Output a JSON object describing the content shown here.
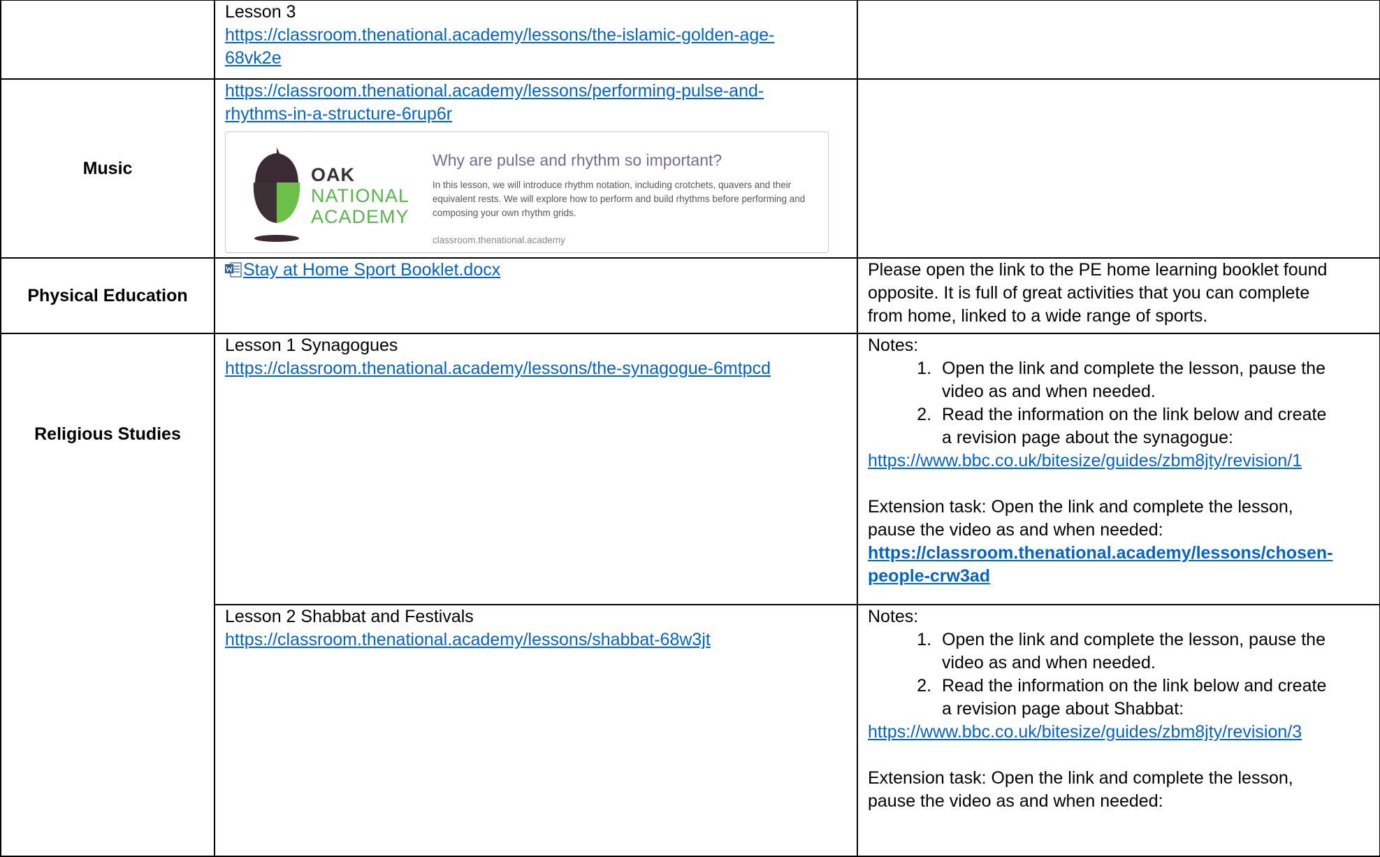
{
  "rows": {
    "row_lesson3": {
      "label": "Lesson 3",
      "link": "https://classroom.thenational.academy/lessons/the-islamic-golden-age-68vk2e",
      "link_line1": "https://classroom.thenational.academy/lessons/the-islamic-golden-age-",
      "link_line2": "68vk2e"
    },
    "music": {
      "subject": "Music",
      "link": "https://classroom.thenational.academy/lessons/performing-pulse-and-rhythms-in-a-structure-6rup6r",
      "link_line1": "https://classroom.thenational.academy/lessons/performing-pulse-and-",
      "link_line2": "rhythms-in-a-structure-6rup6r",
      "card": {
        "brand_line1": "OAK",
        "brand_line2": "NATIONAL",
        "brand_line3": "ACADEMY",
        "title": "Why are pulse and rhythm so important?",
        "description": "In this lesson, we will introduce rhythm notation, including crotchets, quavers and their equivalent rests. We will explore how to perform and build rhythms before performing and composing your own rhythm grids.",
        "url": "classroom.thenational.academy",
        "colors": {
          "acorn_cap": "#3a2a34",
          "acorn_body": "#6cc04a",
          "brand_green": "#56b44a"
        }
      }
    },
    "pe": {
      "subject": "Physical Education",
      "file_icon": "word-doc-icon",
      "file_link": "Stay at Home Sport Booklet.docx",
      "notes": [
        "Please open the link to the PE home learning booklet found",
        "opposite. It is full of great activities that you can complete",
        "from home, linked to a wide range of sports."
      ]
    },
    "rs": {
      "subject": "Religious Studies",
      "lesson1": {
        "title": "Lesson 1 Synagogues",
        "link": "https://classroom.thenational.academy/lessons/the-synagogue-6mtpcd",
        "notes_label": "Notes:",
        "steps": [
          {
            "line1": "Open the link and complete the lesson, pause the",
            "line2": "video as and when needed."
          },
          {
            "line1": "Read the information on the link below and create",
            "line2": "a revision page about the synagogue:"
          }
        ],
        "revision_link": "https://www.bbc.co.uk/bitesize/guides/zbm8jty/revision/1",
        "extension_line1": "Extension task: Open the link and complete the lesson,",
        "extension_line2": "pause the video as and when needed:",
        "extension_link_line1": "https://classroom.thenational.academy/lessons/chosen-",
        "extension_link_line2": "people-crw3ad"
      },
      "lesson2": {
        "title": "Lesson 2 Shabbat and Festivals",
        "link": "https://classroom.thenational.academy/lessons/shabbat-68w3jt",
        "notes_label": "Notes:",
        "steps": [
          {
            "line1": "Open the link and complete the lesson, pause the",
            "line2": "video as and when needed."
          },
          {
            "line1": "Read the information on the link below and create",
            "line2": "a revision page about Shabbat:"
          }
        ],
        "revision_link": "https://www.bbc.co.uk/bitesize/guides/zbm8jty/revision/3",
        "extension_line1": "Extension task: Open the link and complete the lesson,",
        "extension_line2": "pause the video as and when needed:"
      }
    }
  },
  "colors": {
    "link": "#0563c1",
    "border": "#000000"
  }
}
